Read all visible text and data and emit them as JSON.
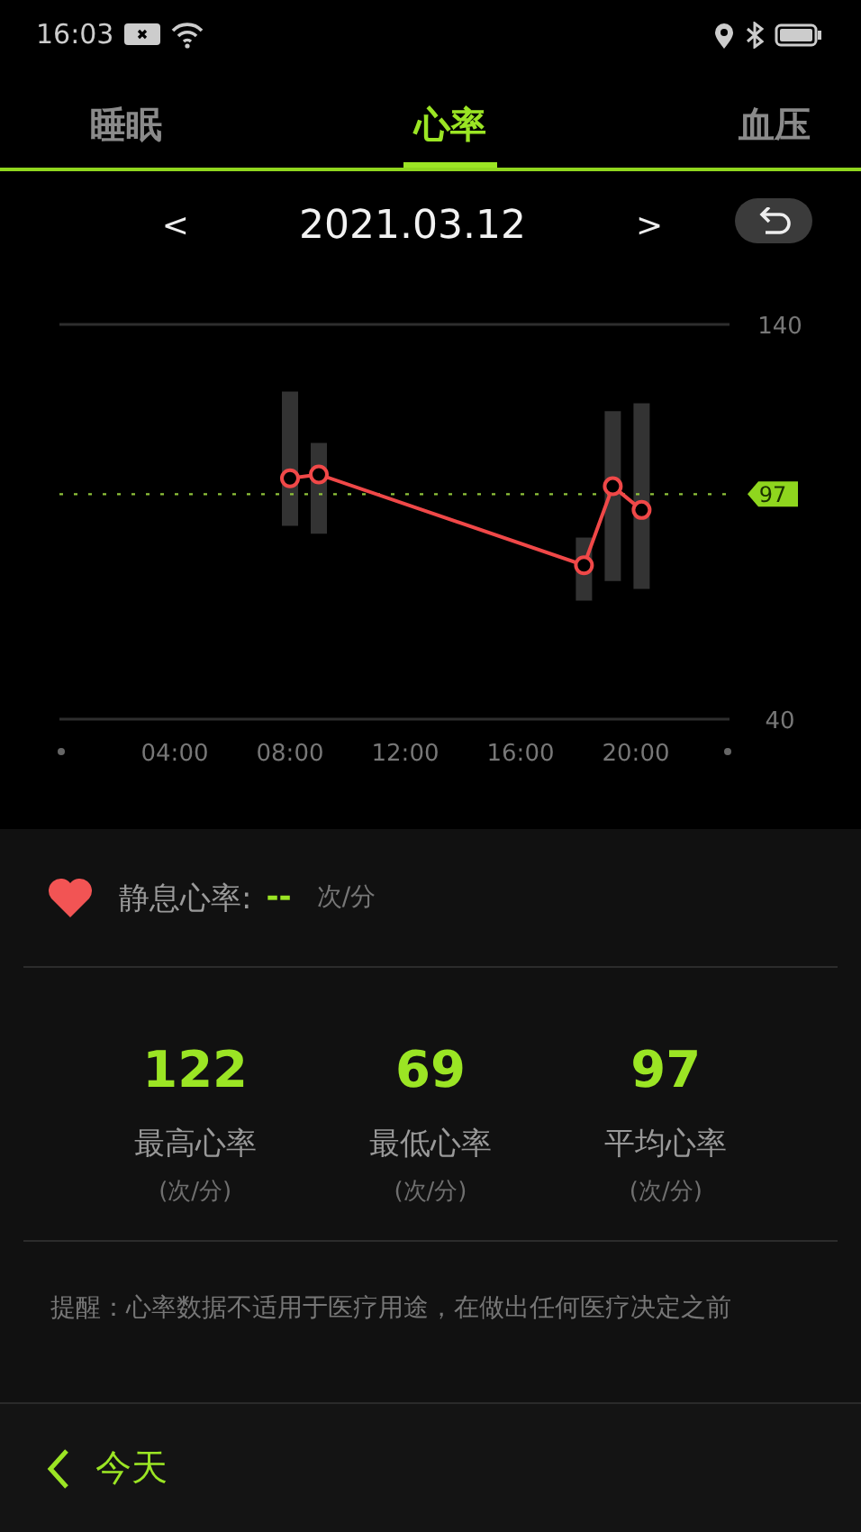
{
  "status_bar": {
    "time": "16:03"
  },
  "tabs": [
    {
      "label": "睡眠",
      "selected": false
    },
    {
      "label": "心率",
      "selected": true
    },
    {
      "label": "血压",
      "selected": false
    }
  ],
  "date_nav": {
    "prev": "<",
    "date": "2021.03.12",
    "next": ">"
  },
  "heart_rate_chart": {
    "chart_data": {
      "type": "line",
      "xlim": [
        0,
        23.25
      ],
      "ylim": [
        40,
        140
      ],
      "xticks": [
        {
          "value": 4,
          "label": "04:00"
        },
        {
          "value": 8,
          "label": "08:00"
        },
        {
          "value": 12,
          "label": "12:00"
        },
        {
          "value": 16,
          "label": "16:00"
        },
        {
          "value": 20,
          "label": "20:00"
        }
      ],
      "yticks": [
        40,
        140
      ],
      "x": [
        8,
        9,
        18.2,
        19.2,
        20.2
      ],
      "series": [
        {
          "color": "#f04848",
          "marker": "o",
          "values": [
            101,
            102,
            79,
            99,
            93
          ],
          "errors": [
            [
              89,
              123
            ],
            [
              87,
              110
            ],
            [
              70,
              86
            ],
            [
              75,
              118
            ],
            [
              73,
              120
            ]
          ]
        }
      ],
      "ref_lines": [
        {
          "axis": "y",
          "value": 97,
          "label": "97",
          "color": "#8fc23a"
        }
      ]
    }
  },
  "resting": {
    "label": "静息心率:",
    "value": "--",
    "unit": "次/分"
  },
  "stats": [
    {
      "value": "122",
      "label": "最高心率",
      "unit": "(次/分)"
    },
    {
      "value": "69",
      "label": "最低心率",
      "unit": "(次/分)"
    },
    {
      "value": "97",
      "label": "平均心率",
      "unit": "(次/分)"
    }
  ],
  "note": "提醒：心率数据不适用于医疗用途，在做出任何医疗决定之前",
  "bottom_bar": {
    "label": "今天"
  }
}
